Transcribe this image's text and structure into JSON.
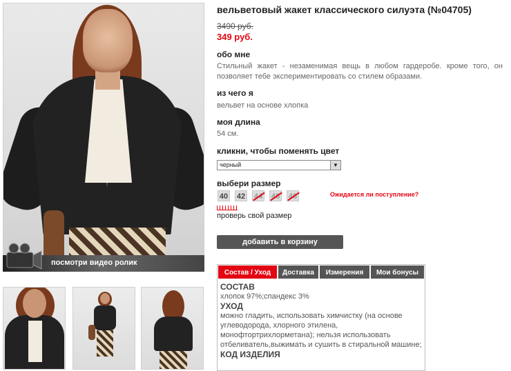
{
  "product": {
    "title": "вельветовый жакет классического силуэта (№04705)",
    "old_price": "3490 руб.",
    "new_price": "349 руб."
  },
  "about": {
    "heading": "обо мне",
    "text": "Стильный жакет - незаменимая вещь в любом гардеробе. кроме того, он позволяет тебе экспериментировать со стилем образами."
  },
  "material": {
    "heading": "из чего я",
    "text": "вельвет на основе хлопка"
  },
  "length": {
    "heading": "моя длина",
    "text": "54 см."
  },
  "color": {
    "heading": "кликни, чтобы поменять цвет",
    "selected": "черный"
  },
  "size": {
    "heading": "выбери размер",
    "options": [
      {
        "label": "40",
        "available": true
      },
      {
        "label": "42",
        "available": true
      },
      {
        "label": "44",
        "available": false
      },
      {
        "label": "46",
        "available": false
      },
      {
        "label": "48",
        "available": false
      }
    ],
    "awaiting_link": "Ожидается ли поступление?",
    "check_size_link": "проверь свой размер"
  },
  "cart_button": "добавить в корзину",
  "video_label": "посмотри видео ролик",
  "tabs": [
    {
      "label": "Состав / Уход",
      "active": true
    },
    {
      "label": "Доставка",
      "active": false
    },
    {
      "label": "Измерения",
      "active": false
    },
    {
      "label": "Мои бонусы",
      "active": false
    }
  ],
  "tab_content": {
    "composition_heading": "СОСТАВ",
    "composition": "хлопок 97%;спандекс 3%",
    "care_heading": "УХОД",
    "care": "можно гладить, использовать химчистку (на основе углеводорода, хлорного этилена, монофтортрихлорметана); нельзя использовать отбеливатель,выжимать и сушить в стиральной машине;",
    "code_heading": "КОД ИЗДЕЛИЯ"
  },
  "colors": {
    "accent_red": "#e30613",
    "tab_gray": "#555555",
    "button_gray": "#555555"
  }
}
